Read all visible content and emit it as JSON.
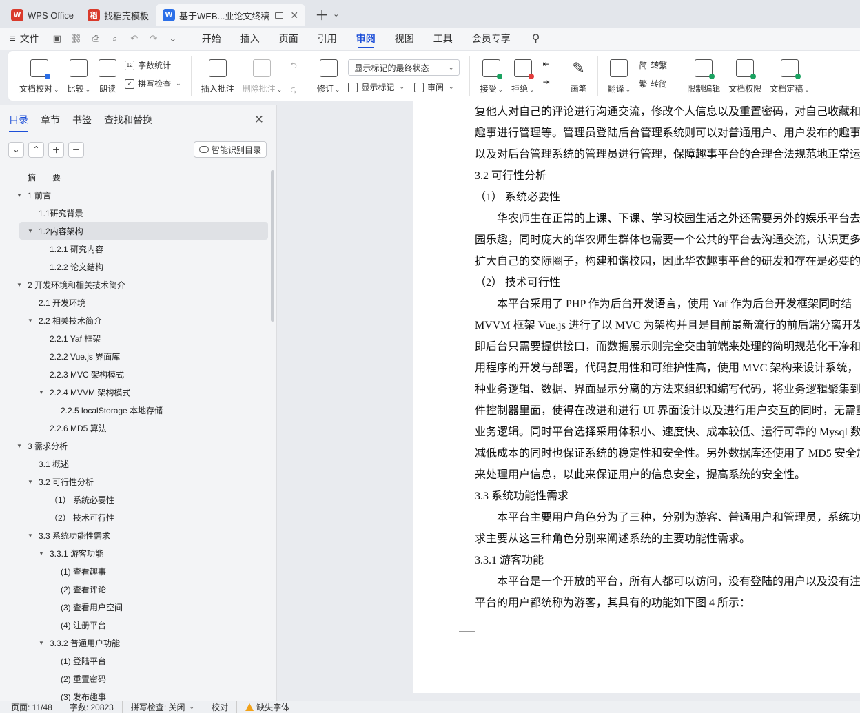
{
  "tabs": [
    {
      "label": "WPS Office",
      "logo": "W",
      "color": "#d93a2b"
    },
    {
      "label": "找稻壳模板",
      "logo": "稻",
      "color": "#d93a2b"
    },
    {
      "label": "基于WEB...业论文终稿",
      "logo": "W",
      "color": "#2b6fe8",
      "active": true
    }
  ],
  "menu": {
    "file": "文件",
    "tabs": [
      "开始",
      "插入",
      "页面",
      "引用",
      "审阅",
      "视图",
      "工具",
      "会员专享"
    ],
    "active": "审阅"
  },
  "ribbon": {
    "proofread": "文档校对",
    "compare": "比较",
    "read_aloud": "朗读",
    "word_count": "字数统计",
    "spell_check": "拼写检查",
    "insert_comment": "插入批注",
    "delete_comment": "删除批注",
    "track_changes": "修订",
    "markup_state": "显示标记的最终状态",
    "show_markup": "显示标记",
    "review": "审阅",
    "accept": "接受",
    "reject": "拒绝",
    "pen": "画笔",
    "translate": "翻译",
    "to_traditional": "转繁",
    "to_simplified": "转简",
    "restrict_edit": "限制编辑",
    "permissions": "文档权限",
    "finalize": "文档定稿"
  },
  "nav": {
    "tabs": [
      "目录",
      "章节",
      "书签",
      "查找和替换"
    ],
    "smart_button": "智能识别目录",
    "toc": [
      {
        "label": "摘　　要",
        "level": 0,
        "arrow": ""
      },
      {
        "label": "1  前言",
        "level": 0,
        "arrow": "▼"
      },
      {
        "label": "1.1研究背景",
        "level": 1,
        "arrow": ""
      },
      {
        "label": "1.2内容架构",
        "level": 1,
        "arrow": "▼",
        "selected": true
      },
      {
        "label": "1.2.1  研究内容",
        "level": 2,
        "arrow": ""
      },
      {
        "label": "1.2.2  论文结构",
        "level": 2,
        "arrow": ""
      },
      {
        "label": "2  开发环境和相关技术简介",
        "level": 0,
        "arrow": "▼"
      },
      {
        "label": "2.1  开发环境",
        "level": 1,
        "arrow": ""
      },
      {
        "label": "2.2  相关技术简介",
        "level": 1,
        "arrow": "▼"
      },
      {
        "label": "2.2.1 Yaf 框架",
        "level": 2,
        "arrow": ""
      },
      {
        "label": "2.2.2 Vue.js 界面库",
        "level": 2,
        "arrow": ""
      },
      {
        "label": "2.2.3 MVC 架构模式",
        "level": 2,
        "arrow": ""
      },
      {
        "label": "2.2.4 MVVM 架构模式",
        "level": 2,
        "arrow": "▼"
      },
      {
        "label": "2.2.5 localStorage 本地存储",
        "level": 3,
        "arrow": ""
      },
      {
        "label": "2.2.6 MD5 算法",
        "level": 2,
        "arrow": ""
      },
      {
        "label": "3  需求分析",
        "level": 0,
        "arrow": "▼"
      },
      {
        "label": "3.1  概述",
        "level": 1,
        "arrow": ""
      },
      {
        "label": "3.2  可行性分析",
        "level": 1,
        "arrow": "▼"
      },
      {
        "label": "（1）  系统必要性",
        "level": 2,
        "arrow": ""
      },
      {
        "label": "（2）  技术可行性",
        "level": 2,
        "arrow": ""
      },
      {
        "label": "3.3  系统功能性需求",
        "level": 1,
        "arrow": "▼"
      },
      {
        "label": "3.3.1  游客功能",
        "level": 2,
        "arrow": "▼"
      },
      {
        "label": "(1)  查看趣事",
        "level": 3,
        "arrow": ""
      },
      {
        "label": "(2)  查看评论",
        "level": 3,
        "arrow": ""
      },
      {
        "label": "(3)  查看用户空间",
        "level": 3,
        "arrow": ""
      },
      {
        "label": "(4)  注册平台",
        "level": 3,
        "arrow": ""
      },
      {
        "label": "3.3.2  普通用户功能",
        "level": 2,
        "arrow": "▼"
      },
      {
        "label": "(1)  登陆平台",
        "level": 3,
        "arrow": ""
      },
      {
        "label": "(2)  重置密码",
        "level": 3,
        "arrow": ""
      },
      {
        "label": "(3)  发布趣事",
        "level": 3,
        "arrow": ""
      }
    ]
  },
  "document": {
    "lines": [
      "复他人对自己的评论进行沟通交流，修改个人信息以及重置密码，对自己收藏和",
      "趣事进行管理等。管理员登陆后台管理系统则可以对普通用户、用户发布的趣事",
      "以及对后台管理系统的管理员进行管理，保障趣事平台的合理合法规范地正常运",
      "3.2  可行性分析",
      "（1）  系统必要性",
      "　　华农师生在正常的上课、下课、学习校园生活之外还需要另外的娱乐平台去",
      "园乐趣，同时庞大的华农师生群体也需要一个公共的平台去沟通交流，认识更多的",
      "扩大自己的交际圈子，构建和谐校园，因此华农趣事平台的研发和存在是必要的",
      "（2）  技术可行性",
      "　　本平台采用了 PHP 作为后台开发语言，使用 Yaf 作为后台开发框架同时结",
      "MVVM 框架 Vue.js 进行了以 MVC 为架构并且是目前最新流行的前后端分离开发",
      "即后台只需要提供接口，而数据展示则完全交由前端来处理的简明规范化干净和",
      "用程序的开发与部署，代码复用性和可维护性高，使用 MVC 架构来设计系统，",
      "种业务逻辑、数据、界面显示分离的方法来组织和编写代码，将业务逻辑聚集到",
      "件控制器里面，使得在改进和进行 UI 界面设计以及进行用户交互的同时，无需重",
      "业务逻辑。同时平台选择采用体积小、速度快、成本较低、运行可靠的 Mysql 数",
      "减低成本的同时也保证系统的稳定性和安全性。另外数据库还使用了 MD5 安全加",
      "来处理用户信息，以此来保证用户的信息安全，提高系统的安全性。",
      "3.3  系统功能性需求",
      "　　本平台主要用户角色分为了三种，分别为游客、普通用户和管理员，系统功",
      "求主要从这三种角色分别来阐述系统的主要功能性需求。",
      "3.3.1  游客功能",
      "　　本平台是一个开放的平台，所有人都可以访问，没有登陆的用户以及没有注",
      "平台的用户都统称为游客，其具有的功能如下图 4 所示："
    ]
  },
  "status": {
    "page": "页面: 11/48",
    "words": "字数: 20823",
    "spell": "拼写检查: 关闭",
    "proof": "校对",
    "missing_font": "缺失字体"
  }
}
